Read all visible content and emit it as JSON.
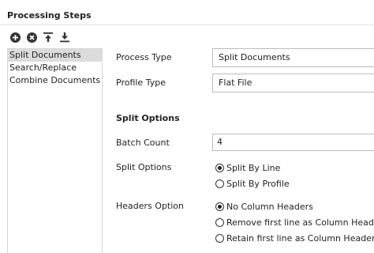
{
  "panel": {
    "title": "Processing Steps"
  },
  "toolbar": {
    "buttons": [
      {
        "icon": "add-circle-icon",
        "label": ""
      },
      {
        "icon": "remove-circle-icon",
        "label": ""
      },
      {
        "icon": "move-to-top-icon",
        "label": ""
      },
      {
        "icon": "move-to-bottom-icon",
        "label": ""
      }
    ]
  },
  "steps": {
    "items": [
      {
        "label": "Split Documents",
        "selected": true
      },
      {
        "label": "Search/Replace",
        "selected": false
      },
      {
        "label": "Combine Documents",
        "selected": false
      }
    ]
  },
  "form": {
    "process_type_label": "Process Type",
    "process_type_value": "Split Documents",
    "profile_type_label": "Profile Type",
    "profile_type_value": "Flat File",
    "split_section_title": "Split Options",
    "batch_count_label": "Batch Count",
    "batch_count_value": "4",
    "split_options_label": "Split Options",
    "split_options": [
      {
        "label": "Split By Line",
        "checked": true
      },
      {
        "label": "Split By Profile",
        "checked": false
      }
    ],
    "headers_option_label": "Headers Option",
    "headers_options": [
      {
        "label": "No Column Headers",
        "checked": true
      },
      {
        "label": "Remove first line as Column Headers",
        "checked": false
      },
      {
        "label": "Retain first line as Column Headers",
        "checked": false
      }
    ]
  }
}
